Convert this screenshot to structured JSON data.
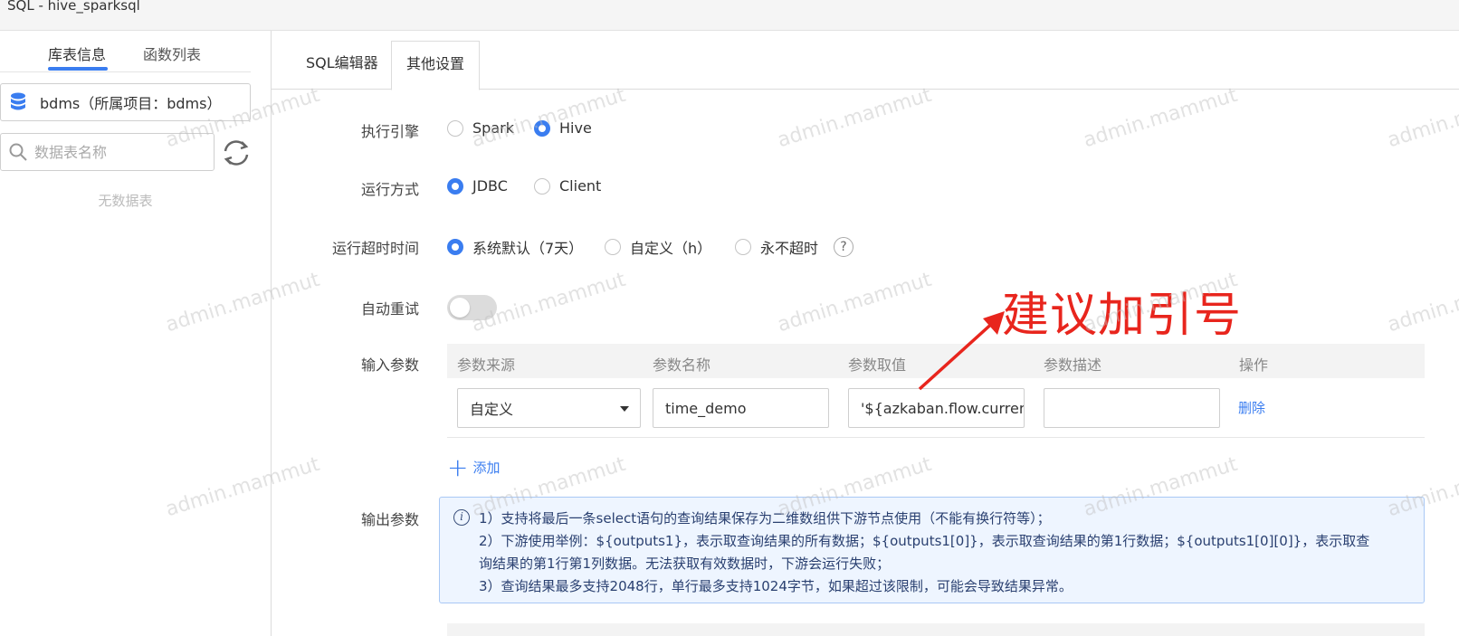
{
  "window": {
    "title": "SQL - hive_sparksql"
  },
  "sidebar": {
    "tabs": [
      {
        "label": "库表信息"
      },
      {
        "label": "函数列表"
      }
    ],
    "database": {
      "label": "bdms（所属项目：bdms）"
    },
    "search": {
      "placeholder": "数据表名称"
    },
    "empty_text": "无数据表"
  },
  "main": {
    "tabs": [
      {
        "label": "SQL编辑器"
      },
      {
        "label": "其他设置"
      }
    ],
    "engine": {
      "label": "执行引擎",
      "options": [
        "Spark",
        "Hive"
      ],
      "selected": "Hive"
    },
    "run_mode": {
      "label": "运行方式",
      "options": [
        "JDBC",
        "Client"
      ],
      "selected": "JDBC"
    },
    "timeout": {
      "label": "运行超时时间",
      "options": [
        "系统默认（7天）",
        "自定义（h）",
        "永不超时"
      ],
      "selected": "系统默认（7天）",
      "help": "?"
    },
    "auto_retry": {
      "label": "自动重试",
      "enabled": false
    },
    "input_params": {
      "label": "输入参数",
      "columns": [
        "参数来源",
        "参数名称",
        "参数取值",
        "参数描述",
        "操作"
      ],
      "rows": [
        {
          "source": "自定义",
          "name": "time_demo",
          "value": "'${azkaban.flow.curren",
          "description": "",
          "action": "删除"
        }
      ],
      "add_label": "添加"
    },
    "output_params": {
      "label": "输出参数",
      "info_lines": [
        "1）支持将最后一条select语句的查询结果保存为二维数组供下游节点使用（不能有换行符等）；",
        "2）下游使用举例：${outputs1}，表示取查询结果的所有数据；${outputs1[0]}，表示取查询结果的第1行数据；${outputs1[0][0]}，表示取查",
        "询结果的第1行第1列数据。无法获取有效数据时，下游会运行失败；",
        "3）查询结果最多支持2048行，单行最多支持1024字节，如果超过该限制，可能会导致结果异常。"
      ]
    }
  },
  "annotation": {
    "text": "建议加引号",
    "color": "#e8251d"
  },
  "watermark": "admin.mammut",
  "colors": {
    "accent": "#3a7df0",
    "info_bg": "#eef5ff"
  }
}
